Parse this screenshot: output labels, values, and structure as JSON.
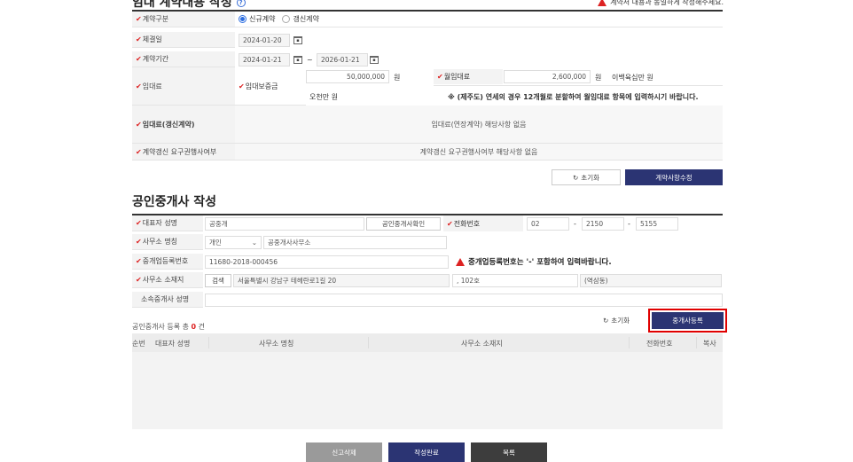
{
  "header": {
    "title": "임대 계약내용 작성",
    "notice": "계약서 내용과 동일하게 작성해주세요."
  },
  "contract": {
    "type_label": "계약구분",
    "type_opt_new": "신규계약",
    "type_opt_renew": "갱신계약",
    "date_label": "체결일",
    "date_value": "2024-01-20",
    "period_label": "계약기간",
    "period_start": "2024-01-21",
    "period_sep": "~",
    "period_end": "2026-01-21",
    "rent_label": "임대료",
    "deposit_label": "임대보증금",
    "deposit_value": "50,000,000",
    "deposit_unit": "원",
    "deposit_words": "오천만 원",
    "monthly_label": "월임대료",
    "monthly_value": "2,600,000",
    "monthly_unit": "원",
    "monthly_words": "이백육십만 원",
    "jeju_note": "※ (제주도) 연세의 경우 12개월로 분할하여 월임대료 항목에 입력하시기 바랍니다.",
    "renew_rent_label": "임대료(갱신계약)",
    "renew_rent_value": "임대료(연장계약) 해당사항 없음",
    "renew_req_label": "계약갱신 요구권행사여부",
    "renew_req_value": "계약갱신 요구권행사여부 해당사항 없음",
    "reset_btn": "초기화",
    "modify_btn": "계약사항수정"
  },
  "agent": {
    "title": "공인중개사 작성",
    "rep_label": "대표자 성명",
    "rep_value": "공중개",
    "verify_btn": "공인중개사확인",
    "phone_label": "전화번호",
    "phone1": "02",
    "phone2": "2150",
    "phone3": "5155",
    "dash": "-",
    "office_label": "사무소 명칭",
    "office_type": "개인",
    "office_name": "공중개사사무소",
    "reg_label": "중개업등록번호",
    "reg_value": "11680-2018-000456",
    "reg_warn": "중개업등록번호는 '-' 포함하여 입력바랍니다.",
    "addr_label": "사무소 소재지",
    "addr_search_btn": "검색",
    "addr_value": "서울특별시 강남구 테헤란로1길 20",
    "addr_detail": ", 102호",
    "addr_extra": "(역삼동)",
    "member_label": "소속중개사 성명",
    "count_prefix": "공인중개사 등록 총",
    "count_value": "0",
    "count_suffix": "건",
    "reset_btn": "초기화",
    "register_btn": "중개사등록",
    "columns": [
      "순번",
      "대표자 성명",
      "사무소 명칭",
      "사무소 소재지",
      "전화번호",
      "복사"
    ]
  },
  "footer": {
    "delete_btn": "신고삭제",
    "complete_btn": "작성완료",
    "list_btn": "목록"
  },
  "colors": {
    "accent": "#2b3473",
    "required": "#d22222",
    "highlight": "#e00000"
  }
}
